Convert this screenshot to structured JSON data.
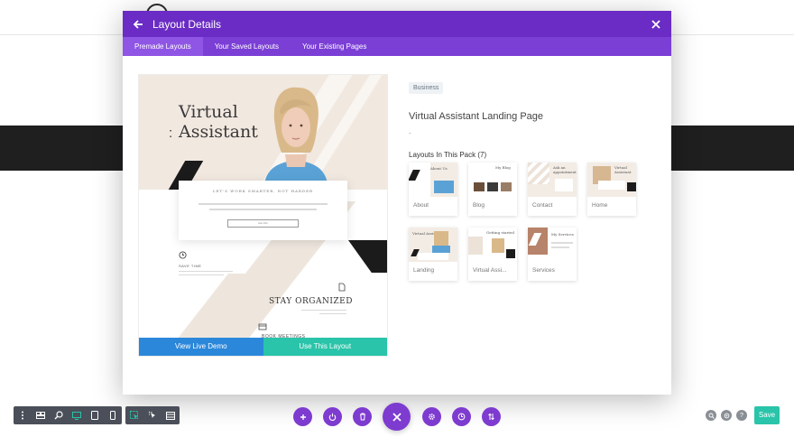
{
  "modal": {
    "title": "Layout Details",
    "tabs": [
      {
        "label": "Premade Layouts",
        "active": true
      },
      {
        "label": "Your Saved Layouts",
        "active": false
      },
      {
        "label": "Your Existing Pages",
        "active": false
      }
    ]
  },
  "preview": {
    "hero_title_line1": "Virtual",
    "hero_title_line2": "Assistant",
    "card_heading": "LET'S WORK SMARTER, NOT HARDER",
    "card_button": "Get Info",
    "save_time": "SAVE TIME",
    "stay_organized": "STAY ORGANIZED",
    "bottom_heading": "BOOK MEETINGS",
    "view_demo_label": "View Live Demo",
    "use_layout_label": "Use This Layout"
  },
  "details": {
    "tag": "Business",
    "layout_name": "Virtual Assistant Landing Page",
    "description": "-",
    "pack_heading": "Layouts In This Pack (7)",
    "pack_items": [
      {
        "label": "About",
        "icon": "about-thumbnail"
      },
      {
        "label": "Blog",
        "icon": "blog-thumbnail"
      },
      {
        "label": "Contact",
        "icon": "contact-thumbnail"
      },
      {
        "label": "Home",
        "icon": "home-thumbnail"
      },
      {
        "label": "Landing",
        "icon": "landing-thumbnail"
      },
      {
        "label": "Virtual Assi...",
        "icon": "virtual-assistant-thumbnail"
      },
      {
        "label": "Services",
        "icon": "services-thumbnail"
      }
    ]
  },
  "toolbar": {
    "save_label": "Save",
    "icons": [
      "menu-dots-icon",
      "wireframe-icon",
      "zoom-icon",
      "desktop-icon",
      "tablet-icon",
      "phone-icon",
      "click-mode-icon",
      "hover-mode-icon",
      "grid-mode-icon"
    ],
    "center_icons": [
      "add-icon",
      "power-icon",
      "trash-icon",
      "close-icon",
      "settings-icon",
      "history-icon",
      "portability-icon"
    ],
    "right_icons": [
      "search-icon",
      "layers-icon",
      "help-icon"
    ]
  },
  "colors": {
    "purple_header": "#6a2cc4",
    "purple_tabs": "#7b3fd6",
    "blue_action": "#2b87da",
    "teal_action": "#29c4a9"
  }
}
